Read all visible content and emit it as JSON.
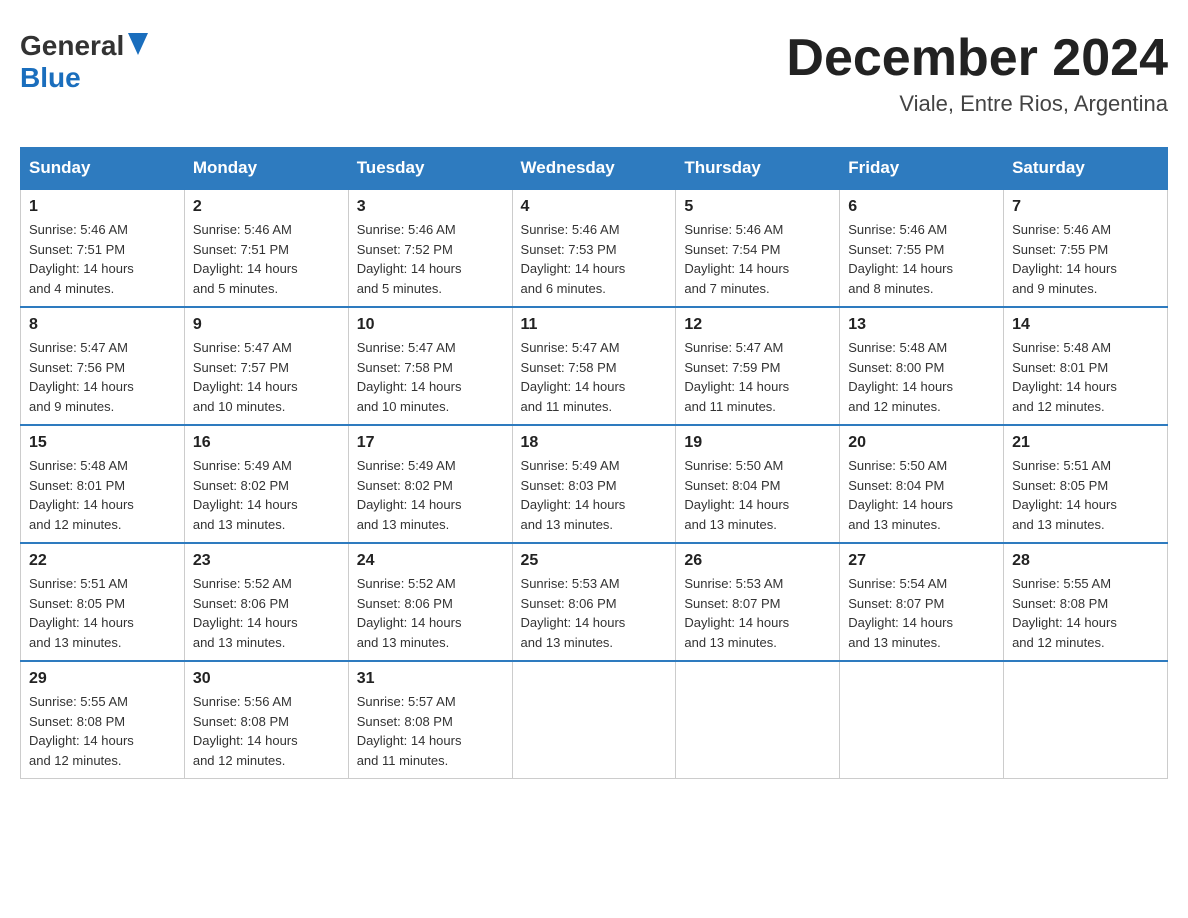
{
  "header": {
    "logo_general": "General",
    "logo_blue": "Blue",
    "title": "December 2024",
    "subtitle": "Viale, Entre Rios, Argentina"
  },
  "weekdays": [
    "Sunday",
    "Monday",
    "Tuesday",
    "Wednesday",
    "Thursday",
    "Friday",
    "Saturday"
  ],
  "weeks": [
    [
      {
        "day": "1",
        "sunrise": "Sunrise: 5:46 AM",
        "sunset": "Sunset: 7:51 PM",
        "daylight": "Daylight: 14 hours and 4 minutes."
      },
      {
        "day": "2",
        "sunrise": "Sunrise: 5:46 AM",
        "sunset": "Sunset: 7:51 PM",
        "daylight": "Daylight: 14 hours and 5 minutes."
      },
      {
        "day": "3",
        "sunrise": "Sunrise: 5:46 AM",
        "sunset": "Sunset: 7:52 PM",
        "daylight": "Daylight: 14 hours and 5 minutes."
      },
      {
        "day": "4",
        "sunrise": "Sunrise: 5:46 AM",
        "sunset": "Sunset: 7:53 PM",
        "daylight": "Daylight: 14 hours and 6 minutes."
      },
      {
        "day": "5",
        "sunrise": "Sunrise: 5:46 AM",
        "sunset": "Sunset: 7:54 PM",
        "daylight": "Daylight: 14 hours and 7 minutes."
      },
      {
        "day": "6",
        "sunrise": "Sunrise: 5:46 AM",
        "sunset": "Sunset: 7:55 PM",
        "daylight": "Daylight: 14 hours and 8 minutes."
      },
      {
        "day": "7",
        "sunrise": "Sunrise: 5:46 AM",
        "sunset": "Sunset: 7:55 PM",
        "daylight": "Daylight: 14 hours and 9 minutes."
      }
    ],
    [
      {
        "day": "8",
        "sunrise": "Sunrise: 5:47 AM",
        "sunset": "Sunset: 7:56 PM",
        "daylight": "Daylight: 14 hours and 9 minutes."
      },
      {
        "day": "9",
        "sunrise": "Sunrise: 5:47 AM",
        "sunset": "Sunset: 7:57 PM",
        "daylight": "Daylight: 14 hours and 10 minutes."
      },
      {
        "day": "10",
        "sunrise": "Sunrise: 5:47 AM",
        "sunset": "Sunset: 7:58 PM",
        "daylight": "Daylight: 14 hours and 10 minutes."
      },
      {
        "day": "11",
        "sunrise": "Sunrise: 5:47 AM",
        "sunset": "Sunset: 7:58 PM",
        "daylight": "Daylight: 14 hours and 11 minutes."
      },
      {
        "day": "12",
        "sunrise": "Sunrise: 5:47 AM",
        "sunset": "Sunset: 7:59 PM",
        "daylight": "Daylight: 14 hours and 11 minutes."
      },
      {
        "day": "13",
        "sunrise": "Sunrise: 5:48 AM",
        "sunset": "Sunset: 8:00 PM",
        "daylight": "Daylight: 14 hours and 12 minutes."
      },
      {
        "day": "14",
        "sunrise": "Sunrise: 5:48 AM",
        "sunset": "Sunset: 8:01 PM",
        "daylight": "Daylight: 14 hours and 12 minutes."
      }
    ],
    [
      {
        "day": "15",
        "sunrise": "Sunrise: 5:48 AM",
        "sunset": "Sunset: 8:01 PM",
        "daylight": "Daylight: 14 hours and 12 minutes."
      },
      {
        "day": "16",
        "sunrise": "Sunrise: 5:49 AM",
        "sunset": "Sunset: 8:02 PM",
        "daylight": "Daylight: 14 hours and 13 minutes."
      },
      {
        "day": "17",
        "sunrise": "Sunrise: 5:49 AM",
        "sunset": "Sunset: 8:02 PM",
        "daylight": "Daylight: 14 hours and 13 minutes."
      },
      {
        "day": "18",
        "sunrise": "Sunrise: 5:49 AM",
        "sunset": "Sunset: 8:03 PM",
        "daylight": "Daylight: 14 hours and 13 minutes."
      },
      {
        "day": "19",
        "sunrise": "Sunrise: 5:50 AM",
        "sunset": "Sunset: 8:04 PM",
        "daylight": "Daylight: 14 hours and 13 minutes."
      },
      {
        "day": "20",
        "sunrise": "Sunrise: 5:50 AM",
        "sunset": "Sunset: 8:04 PM",
        "daylight": "Daylight: 14 hours and 13 minutes."
      },
      {
        "day": "21",
        "sunrise": "Sunrise: 5:51 AM",
        "sunset": "Sunset: 8:05 PM",
        "daylight": "Daylight: 14 hours and 13 minutes."
      }
    ],
    [
      {
        "day": "22",
        "sunrise": "Sunrise: 5:51 AM",
        "sunset": "Sunset: 8:05 PM",
        "daylight": "Daylight: 14 hours and 13 minutes."
      },
      {
        "day": "23",
        "sunrise": "Sunrise: 5:52 AM",
        "sunset": "Sunset: 8:06 PM",
        "daylight": "Daylight: 14 hours and 13 minutes."
      },
      {
        "day": "24",
        "sunrise": "Sunrise: 5:52 AM",
        "sunset": "Sunset: 8:06 PM",
        "daylight": "Daylight: 14 hours and 13 minutes."
      },
      {
        "day": "25",
        "sunrise": "Sunrise: 5:53 AM",
        "sunset": "Sunset: 8:06 PM",
        "daylight": "Daylight: 14 hours and 13 minutes."
      },
      {
        "day": "26",
        "sunrise": "Sunrise: 5:53 AM",
        "sunset": "Sunset: 8:07 PM",
        "daylight": "Daylight: 14 hours and 13 minutes."
      },
      {
        "day": "27",
        "sunrise": "Sunrise: 5:54 AM",
        "sunset": "Sunset: 8:07 PM",
        "daylight": "Daylight: 14 hours and 13 minutes."
      },
      {
        "day": "28",
        "sunrise": "Sunrise: 5:55 AM",
        "sunset": "Sunset: 8:08 PM",
        "daylight": "Daylight: 14 hours and 12 minutes."
      }
    ],
    [
      {
        "day": "29",
        "sunrise": "Sunrise: 5:55 AM",
        "sunset": "Sunset: 8:08 PM",
        "daylight": "Daylight: 14 hours and 12 minutes."
      },
      {
        "day": "30",
        "sunrise": "Sunrise: 5:56 AM",
        "sunset": "Sunset: 8:08 PM",
        "daylight": "Daylight: 14 hours and 12 minutes."
      },
      {
        "day": "31",
        "sunrise": "Sunrise: 5:57 AM",
        "sunset": "Sunset: 8:08 PM",
        "daylight": "Daylight: 14 hours and 11 minutes."
      },
      null,
      null,
      null,
      null
    ]
  ]
}
